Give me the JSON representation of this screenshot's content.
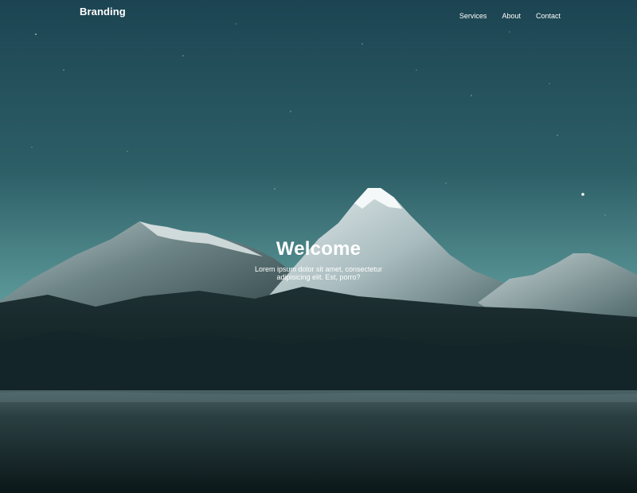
{
  "nav": {
    "brand": "Branding",
    "links": [
      {
        "label": "Services"
      },
      {
        "label": "About"
      },
      {
        "label": "Contact"
      }
    ]
  },
  "hero": {
    "title": "Welcome",
    "text": "Lorem ipsum dolor sit amet, consectetur adipisicing elit. Est, porro?"
  },
  "colors": {
    "sky_top": "#1f4a57",
    "sky_bottom": "#5f9a9c",
    "mountain_snow": "#dde6e8",
    "fog": "#3f5a5d",
    "foreground": "#0c1a1c",
    "text": "#ffffff"
  }
}
